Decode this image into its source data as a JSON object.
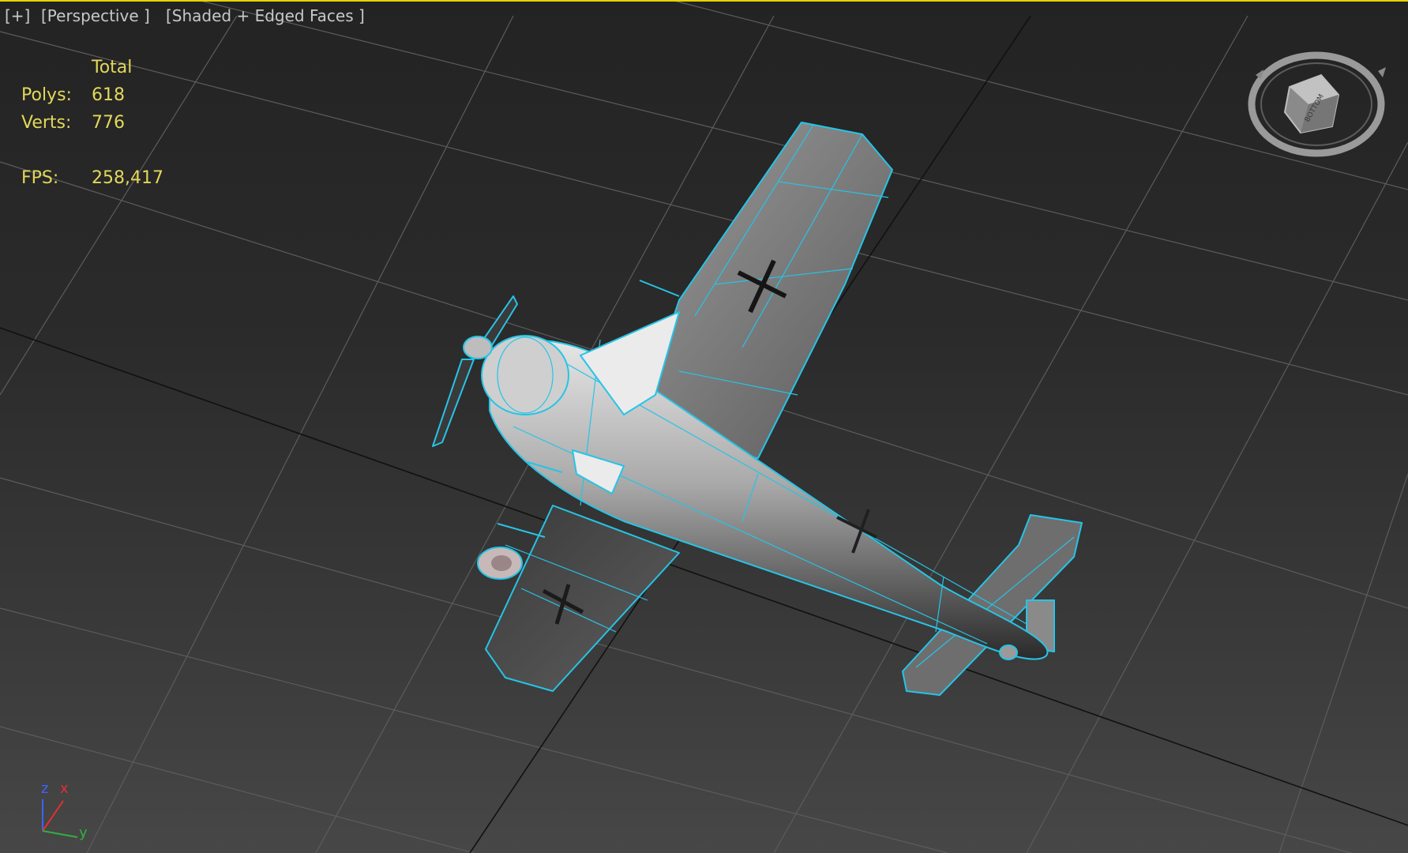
{
  "viewport": {
    "menu_label": "[+]",
    "view_label": "[Perspective ]",
    "shading_label": "[Shaded + Edged Faces ]",
    "border_color": "#e5d400",
    "wire_color": "#26c4e6"
  },
  "statistics": {
    "header": "Total",
    "polys_label": "Polys:",
    "polys_value": "618",
    "verts_label": "Verts:",
    "verts_value": "776",
    "fps_label": "FPS:",
    "fps_value": "258,417",
    "text_color": "#e2d85a"
  },
  "axis_tripod": {
    "z": "z",
    "x": "x",
    "y": "y",
    "z_color": "#3c64ff",
    "x_color": "#e03030",
    "y_color": "#30b040"
  },
  "viewcube": {
    "face_label": "BOTTOM"
  },
  "model": {
    "icon": "airplane-wireframe",
    "marking": "balkenkreuz-cross"
  }
}
